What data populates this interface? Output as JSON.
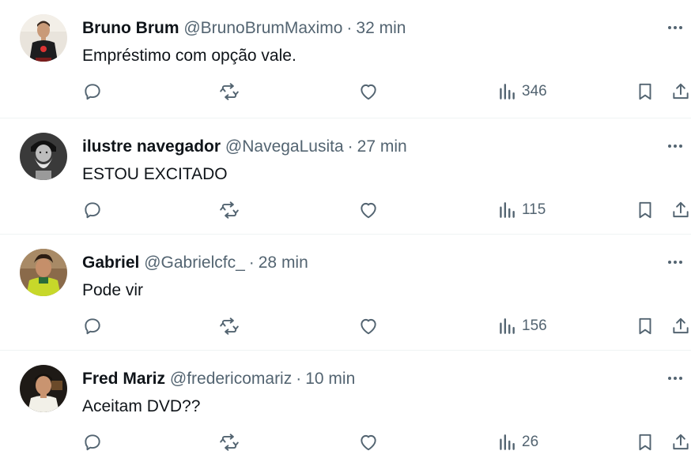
{
  "tweets": [
    {
      "name": "Bruno Brum",
      "handle": "@BrunoBrumMaximo",
      "separator": "·",
      "time": "32 min",
      "text": "Empréstimo com opção vale.",
      "views": "346",
      "avatar": "person-dark-shirt-avatar"
    },
    {
      "name": "ilustre navegador",
      "handle": "@NavegaLusita",
      "separator": "·",
      "time": "27 min",
      "text": "ESTOU EXCITADO",
      "views": "115",
      "avatar": "bearded-portrait-avatar"
    },
    {
      "name": "Gabriel",
      "handle": "@Gabrielcfc_",
      "separator": "·",
      "time": "28 min",
      "text": "Pode vir",
      "views": "156",
      "avatar": "green-jersey-avatar"
    },
    {
      "name": "Fred Mariz",
      "handle": "@fredericomariz",
      "separator": "·",
      "time": "10 min",
      "text": "Aceitam DVD??",
      "views": "26",
      "avatar": "man-dark-background-avatar"
    }
  ],
  "icons": {
    "more": "more-horizontal-icon",
    "reply": "reply-icon",
    "retweet": "retweet-icon",
    "like": "heart-icon",
    "views": "bar-chart-icon",
    "bookmark": "bookmark-icon",
    "share": "share-icon"
  },
  "colors": {
    "text": "#0f1419",
    "secondary": "#536471",
    "divider": "#eff3f4"
  }
}
